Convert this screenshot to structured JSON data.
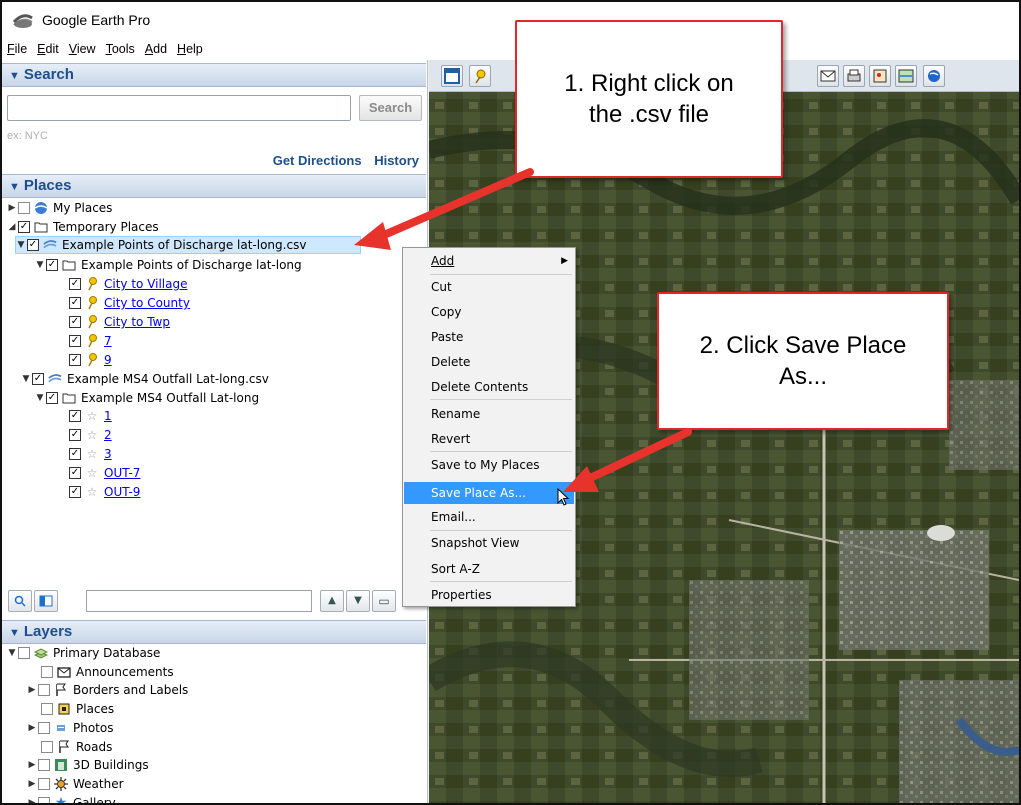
{
  "window": {
    "title": "Google Earth Pro"
  },
  "menu": [
    "File",
    "Edit",
    "View",
    "Tools",
    "Add",
    "Help"
  ],
  "search": {
    "header": "Search",
    "value": "",
    "button": "Search",
    "hint": "ex: NYC",
    "links": [
      "Get Directions",
      "History"
    ]
  },
  "places": {
    "header": "Places",
    "items": [
      {
        "label": "My Places",
        "checked": false
      },
      {
        "label": "Temporary Places",
        "checked": true
      },
      {
        "label": "Example Points of Discharge lat-long.csv",
        "checked": true,
        "selected": true
      },
      {
        "label": "Example Points of Discharge lat-long",
        "checked": true
      },
      {
        "label": "City  to  Village",
        "checked": true,
        "link": true
      },
      {
        "label": "City to County",
        "checked": true,
        "link": true
      },
      {
        "label": "City to Twp",
        "checked": true,
        "link": true
      },
      {
        "label": "7",
        "checked": true,
        "link": true
      },
      {
        "label": "9",
        "checked": true,
        "link": true
      },
      {
        "label": "Example MS4 Outfall Lat-long.csv",
        "checked": true
      },
      {
        "label": "Example MS4 Outfall Lat-long",
        "checked": true
      },
      {
        "label": "1",
        "checked": true,
        "link": true
      },
      {
        "label": "2",
        "checked": true,
        "link": true
      },
      {
        "label": "3",
        "checked": true,
        "link": true
      },
      {
        "label": "OUT-7",
        "checked": true,
        "link": true
      },
      {
        "label": "OUT-9",
        "checked": true,
        "link": true
      }
    ],
    "filter_value": ""
  },
  "layers": {
    "header": "Layers",
    "items": [
      {
        "label": "Primary Database",
        "icon": "database-icon"
      },
      {
        "label": "Announcements",
        "icon": "envelope-icon"
      },
      {
        "label": "Borders and Labels",
        "icon": "flag-icon"
      },
      {
        "label": "Places",
        "icon": "places-square-icon"
      },
      {
        "label": "Photos",
        "icon": "photo-icon"
      },
      {
        "label": "Roads",
        "icon": "road-flag-icon"
      },
      {
        "label": "3D Buildings",
        "icon": "building-icon"
      },
      {
        "label": "Weather",
        "icon": "sun-icon"
      },
      {
        "label": "Gallery",
        "icon": "star-icon"
      }
    ]
  },
  "context_menu": {
    "items": [
      {
        "label": "Add",
        "submenu": true
      },
      {
        "label": "Cut"
      },
      {
        "label": "Copy"
      },
      {
        "label": "Paste"
      },
      {
        "label": "Delete"
      },
      {
        "label": "Delete Contents"
      },
      {
        "label": "Rename"
      },
      {
        "label": "Revert"
      },
      {
        "label": "Save to My Places"
      },
      {
        "label": "Save Place As...",
        "highlighted": true
      },
      {
        "label": "Email..."
      },
      {
        "label": "Snapshot View"
      },
      {
        "label": "Sort A-Z"
      },
      {
        "label": "Properties"
      }
    ]
  },
  "callouts": {
    "step1": "1. Right click on the .csv file",
    "step2": "2. Click Save Place As..."
  },
  "colors": {
    "callout_border": "#e0272a",
    "arrow": "#e8332d",
    "menu_highlight": "#3399ff",
    "header_text": "#1f4e8c",
    "selection": "#cde8ff"
  }
}
